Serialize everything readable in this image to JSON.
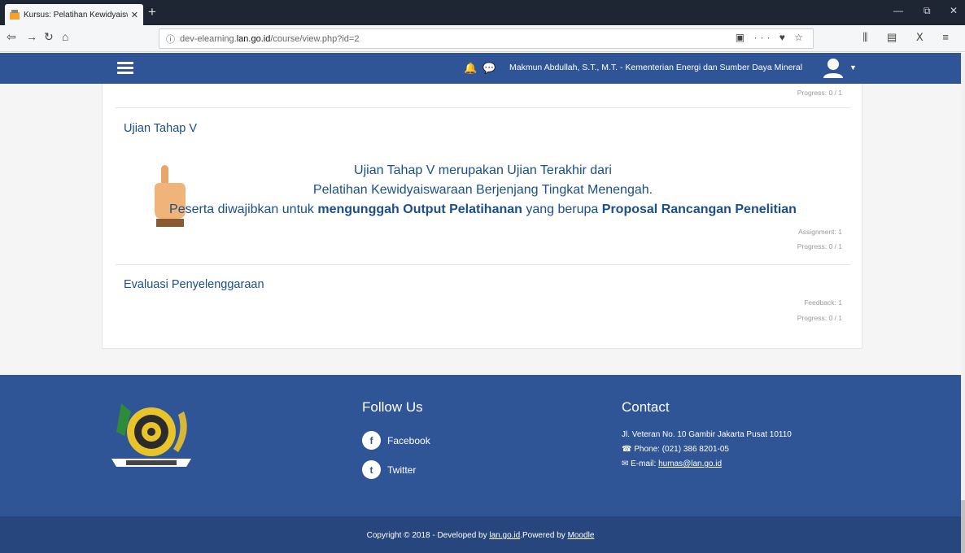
{
  "browser": {
    "tab_title": "Kursus: Pelatihan Kewidyaiswa",
    "tab_close": "✕",
    "new_tab": "+",
    "url_prefix": "dev-elearning.",
    "url_domain": "lan.go.id",
    "url_path": "/course/view.php?id=2",
    "window_controls": [
      "—",
      "⧉",
      "✕"
    ]
  },
  "header": {
    "user_name": "Makmun Abdullah, S.T., M.T. - Kementerian Energi dan Sumber Daya Mineral"
  },
  "sections": [
    {
      "progress": "Progress: 0 / 1"
    },
    {
      "title": "Ujian Tahap V",
      "summary_line1": "Ujian Tahap V merupakan Ujian Terakhir dari",
      "summary_line2": "Pelatihan Kewidyaiswaraan Berjenjang Tingkat Menengah.",
      "summary_line3_a": "Peserta diwajibkan untuk ",
      "summary_line3_b": "mengunggah Output Pelatihanan",
      "summary_line3_c": " yang berupa ",
      "summary_line3_d": "Proposal Rancangan Penelitian",
      "activity": "Assignment: 1",
      "progress": "Progress: 0 / 1"
    },
    {
      "title": "Evaluasi Penyelenggaraan",
      "activity": "Feedback: 1",
      "progress": "Progress: 0 / 1"
    }
  ],
  "footer": {
    "follow_title": "Follow Us",
    "facebook": "Facebook",
    "twitter": "Twitter",
    "contact_title": "Contact",
    "address": "Jl. Veteran No. 10 Gambir Jakarta Pusat 10110",
    "phone": "Phone: (021) 386 8201-05",
    "email_label": "E-mail: ",
    "email": "humas@lan.go.id",
    "copyright_a": "Copyright © 2018 - Developed by ",
    "copyright_link1": "lan.go.id",
    "copyright_b": ".Powered by ",
    "copyright_link2": "Moodle"
  },
  "colors": {
    "brand": "#2f5597",
    "footer_bottom": "#27467e",
    "link_text": "#1a4f8b"
  }
}
